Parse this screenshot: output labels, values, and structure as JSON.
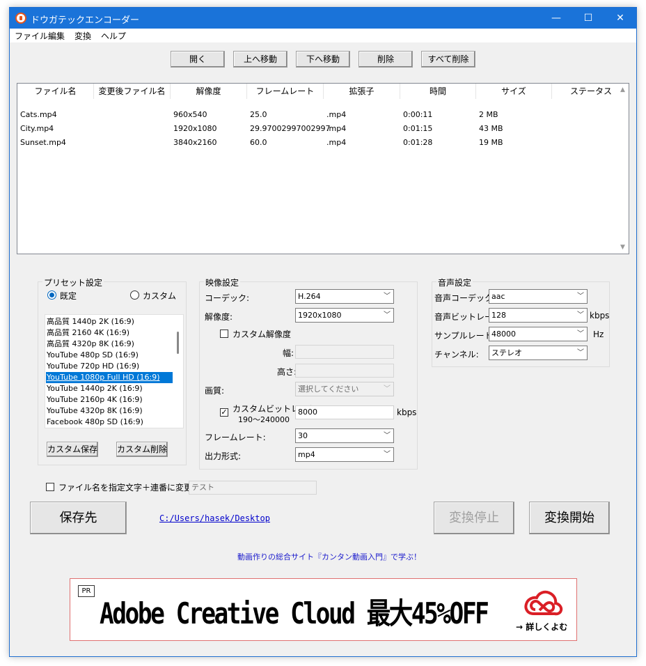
{
  "window": {
    "title": "ドウガテックエンコーダー",
    "minimize_glyph": "—",
    "maximize_glyph": "☐",
    "close_glyph": "✕"
  },
  "menu": [
    "ファイル",
    "編集",
    "変換",
    "ヘルプ"
  ],
  "toolbar": {
    "open": "開く",
    "move_up": "上へ移動",
    "move_down": "下へ移動",
    "delete": "削除",
    "delete_all": "すべて削除"
  },
  "file_list": {
    "columns": [
      "ファイル名",
      "変更後ファイル名",
      "解像度",
      "フレームレート",
      "拡張子",
      "時間",
      "サイズ",
      "ステータス"
    ],
    "rows": [
      {
        "name": "Cats.mp4",
        "new_name": "",
        "resolution": "960x540",
        "framerate": "25.0",
        "ext": ".mp4",
        "duration": "0:00:11",
        "size": "2 MB",
        "status": ""
      },
      {
        "name": "City.mp4",
        "new_name": "",
        "resolution": "1920x1080",
        "framerate": "29.97002997002997",
        "ext": ".mp4",
        "duration": "0:01:15",
        "size": "43 MB",
        "status": ""
      },
      {
        "name": "Sunset.mp4",
        "new_name": "",
        "resolution": "3840x2160",
        "framerate": "60.0",
        "ext": ".mp4",
        "duration": "0:01:28",
        "size": "19 MB",
        "status": ""
      }
    ]
  },
  "preset": {
    "title": "プリセット設定",
    "radio_default": "既定",
    "radio_custom": "カスタム",
    "selected_radio": "既定",
    "items": [
      "高品質 1440p 2K (16:9)",
      "高品質 2160 4K (16:9)",
      "高品質 4320p 8K (16:9)",
      "YouTube 480p SD (16:9)",
      "YouTube 720p HD (16:9)",
      "YouTube 1080p Full HD (16:9)",
      "YouTube 1440p 2K (16:9)",
      "YouTube 2160p 4K (16:9)",
      "YouTube 4320p 8K (16:9)",
      "Facebook 480p SD (16:9)"
    ],
    "selected_index": 5,
    "save_custom": "カスタム保存",
    "delete_custom": "カスタム削除"
  },
  "video": {
    "title": "映像設定",
    "codec_label": "コーデック:",
    "codec_value": "H.264",
    "resolution_label": "解像度:",
    "resolution_value": "1920x1080",
    "custom_res_label": "カスタム解像度",
    "custom_res_checked": false,
    "width_label": "幅:",
    "height_label": "高さ:",
    "quality_label": "画質:",
    "quality_value": "選択してください",
    "custom_bitrate_label": "カスタムビットレート",
    "custom_bitrate_range": "190〜240000",
    "custom_bitrate_checked": true,
    "bitrate_value": "8000",
    "bitrate_unit": "kbps",
    "framerate_label": "フレームレート:",
    "framerate_value": "30",
    "format_label": "出力形式:",
    "format_value": "mp4"
  },
  "audio": {
    "title": "音声設定",
    "codec_label": "音声コーデック:",
    "codec_value": "aac",
    "bitrate_label": "音声ビットレート:",
    "bitrate_value": "128",
    "bitrate_unit": "kbps",
    "samplerate_label": "サンプルレート:",
    "samplerate_value": "48000",
    "samplerate_unit": "Hz",
    "channel_label": "チャンネル:",
    "channel_value": "ステレオ"
  },
  "rename": {
    "label": "ファイル名を指定文字＋連番に変更",
    "checked": false,
    "placeholder": "テスト"
  },
  "output": {
    "save_to": "保存先",
    "path": "C:/Users/hasek/Desktop",
    "stop": "変換停止",
    "start": "変換開始"
  },
  "promo_link": "動画作りの総合サイト『カンタン動画入門』で学ぶ！",
  "banner": {
    "pr": "PR",
    "headline": "Adobe Creative Cloud 最大45%OFF",
    "more": "→ 詳しくよむ",
    "logo_icon": "creative-cloud-logo",
    "accent_color": "#da1f26"
  },
  "colors": {
    "titlebar": "#1a73d9",
    "selection": "#0078d7",
    "link": "#0000cc"
  }
}
